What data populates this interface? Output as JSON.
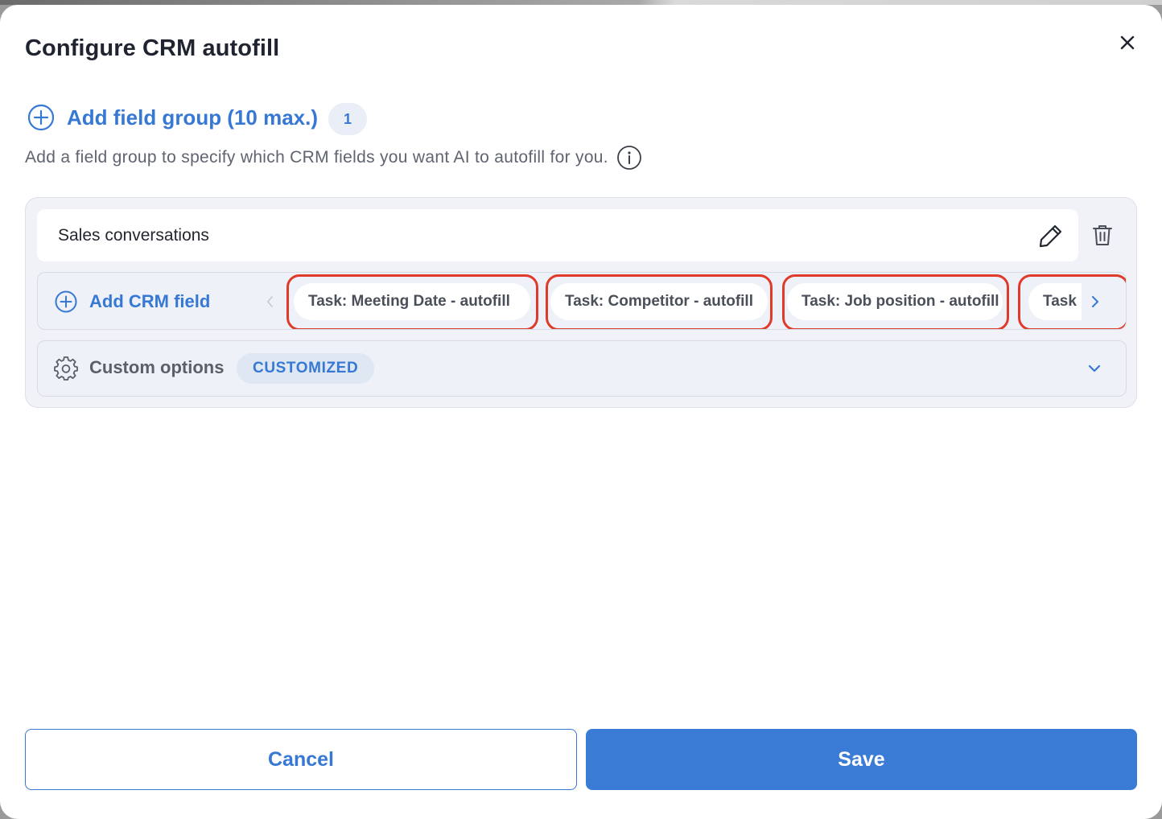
{
  "dialog": {
    "title": "Configure CRM autofill"
  },
  "field_groups": {
    "add_label": "Add field group (10 max.)",
    "count": "1",
    "helper_text": "Add a field group to specify which CRM fields you want AI to autofill for you."
  },
  "group": {
    "name": "Sales conversations",
    "add_field_label": "Add CRM field",
    "fields": [
      "Task: Meeting Date - autofill",
      "Task: Competitor - autofill",
      "Task: Job position - autofill",
      "Task"
    ],
    "custom_options_label": "Custom options",
    "custom_badge": "CUSTOMIZED"
  },
  "footer": {
    "cancel_label": "Cancel",
    "save_label": "Save"
  },
  "colors": {
    "accent": "#3678d4",
    "highlight_outline": "#e03a2a"
  },
  "icons": {
    "close": "close-icon",
    "add": "plus-circle-icon",
    "info": "info-icon",
    "edit": "pencil-icon",
    "delete": "trash-icon",
    "settings": "gear-icon",
    "expand": "chevron-down-icon"
  }
}
